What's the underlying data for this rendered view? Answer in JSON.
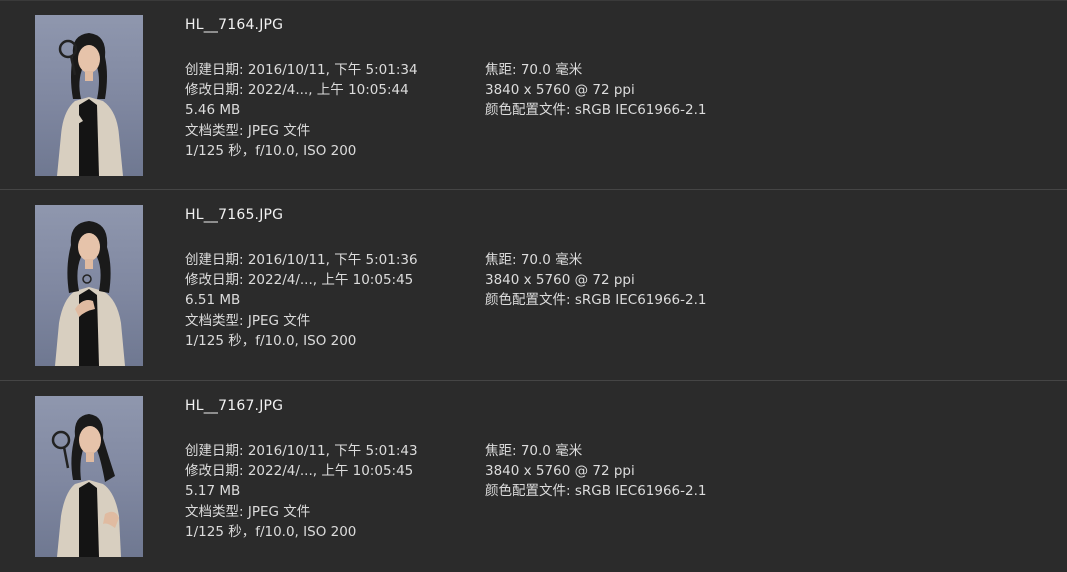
{
  "files": [
    {
      "name": "HL__7164.JPG",
      "created": "创建日期: 2016/10/11, 下午 5:01:34",
      "modified": "修改日期: 2022/4..., 上午 10:05:44",
      "size": "5.46 MB",
      "type": "文档类型: JPEG 文件",
      "exposure": "1/125 秒，f/10.0, ISO 200",
      "focal": "焦距: 70.0 毫米",
      "dimensions": "3840 x 5760 @ 72 ppi",
      "profile": "颜色配置文件: sRGB IEC61966-2.1"
    },
    {
      "name": "HL__7165.JPG",
      "created": "创建日期: 2016/10/11, 下午 5:01:36",
      "modified": "修改日期: 2022/4/..., 上午 10:05:45",
      "size": "6.51 MB",
      "type": "文档类型: JPEG 文件",
      "exposure": "1/125 秒，f/10.0, ISO 200",
      "focal": "焦距: 70.0 毫米",
      "dimensions": "3840 x 5760 @ 72 ppi",
      "profile": "颜色配置文件: sRGB IEC61966-2.1"
    },
    {
      "name": "HL__7167.JPG",
      "created": "创建日期: 2016/10/11, 下午 5:01:43",
      "modified": "修改日期: 2022/4/..., 上午 10:05:45",
      "size": "5.17 MB",
      "type": "文档类型: JPEG 文件",
      "exposure": "1/125 秒，f/10.0, ISO 200",
      "focal": "焦距: 70.0 毫米",
      "dimensions": "3840 x 5760 @ 72 ppi",
      "profile": "颜色配置文件: sRGB IEC61966-2.1"
    }
  ],
  "colors": {
    "background": "#2b2b2b",
    "divider": "#454545",
    "text": "#dcdcdc",
    "title": "#f2f2f2"
  }
}
